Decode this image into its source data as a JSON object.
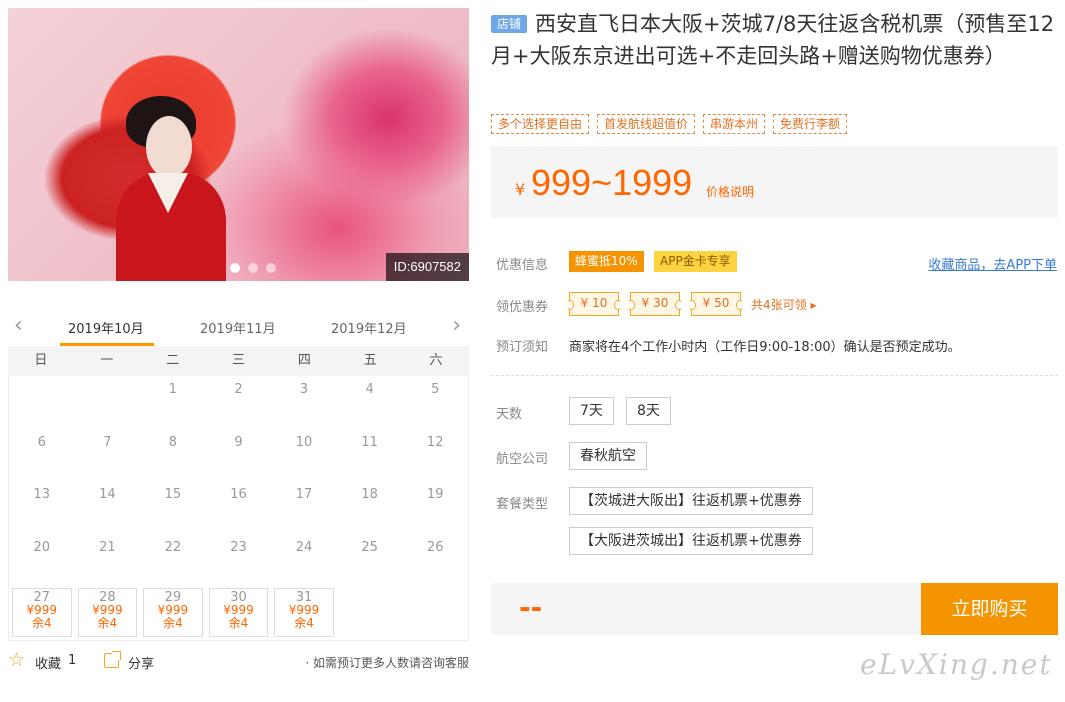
{
  "hero": {
    "id_tag": "ID:6907582",
    "slide_count": 3,
    "active_slide": 1
  },
  "calendar": {
    "months": [
      "2019年10月",
      "2019年11月",
      "2019年12月"
    ],
    "active_month": "2019年10月",
    "weekdays": [
      "日",
      "一",
      "二",
      "三",
      "四",
      "五",
      "六"
    ],
    "days": [
      {
        "d": ""
      },
      {
        "d": ""
      },
      {
        "d": "1"
      },
      {
        "d": "2"
      },
      {
        "d": "3"
      },
      {
        "d": "4"
      },
      {
        "d": "5"
      },
      {
        "d": "6"
      },
      {
        "d": "7"
      },
      {
        "d": "8"
      },
      {
        "d": "9"
      },
      {
        "d": "10"
      },
      {
        "d": "11"
      },
      {
        "d": "12"
      },
      {
        "d": "13"
      },
      {
        "d": "14"
      },
      {
        "d": "15"
      },
      {
        "d": "16"
      },
      {
        "d": "17"
      },
      {
        "d": "18"
      },
      {
        "d": "19"
      },
      {
        "d": "20"
      },
      {
        "d": "21"
      },
      {
        "d": "22"
      },
      {
        "d": "23"
      },
      {
        "d": "24"
      },
      {
        "d": "25"
      },
      {
        "d": "26"
      },
      {
        "d": "27",
        "price": "¥999",
        "stock": "余4"
      },
      {
        "d": "28",
        "price": "¥999",
        "stock": "余4"
      },
      {
        "d": "29",
        "price": "¥999",
        "stock": "余4"
      },
      {
        "d": "30",
        "price": "¥999",
        "stock": "余4"
      },
      {
        "d": "31",
        "price": "¥999",
        "stock": "余4"
      }
    ]
  },
  "footer": {
    "fav_label": "收藏",
    "fav_count": "1",
    "share_label": "分享",
    "note": "· 如需预订更多人数请咨询客服"
  },
  "product": {
    "shop_badge": "店铺",
    "title": "西安直飞日本大阪+茨城7/8天往返含税机票（预售至12月+大阪东京进出可选+不走回头路+赠送购物优惠券）",
    "tags": [
      "多个选择更自由",
      "首发航线超值价",
      "串游本州",
      "免费行李额"
    ],
    "price_currency": "¥",
    "price": "999~1999",
    "price_explain": "价格说明"
  },
  "promo": {
    "label": "优惠信息",
    "bee_badge": "蜂蜜抵10%",
    "app_badge": "APP金卡专享",
    "app_link": "收藏商品，去APP下单"
  },
  "coupons": {
    "label": "领优惠券",
    "items": [
      "¥ 10",
      "¥ 30",
      "¥ 50"
    ],
    "more": "共4张可领 ▸"
  },
  "booking": {
    "label": "预订须知",
    "text": "商家将在4个工作小时内（工作日9:00-18:00）确认是否预定成功。"
  },
  "options": {
    "days_label": "天数",
    "days": [
      "7天",
      "8天"
    ],
    "airline_label": "航空公司",
    "airline": "春秋航空",
    "package_label": "套餐类型",
    "packages": [
      "【茨城进大阪出】往返机票+优惠券",
      "【大阪进茨城出】往返机票+优惠券"
    ]
  },
  "buy": {
    "total": "--",
    "button": "立即购买"
  },
  "watermark": "eLvXing.net",
  "colors": {
    "accent": "#f39400",
    "price": "#ff6600",
    "link": "#3a7bd5",
    "badge_blue": "#6fa7e8"
  }
}
